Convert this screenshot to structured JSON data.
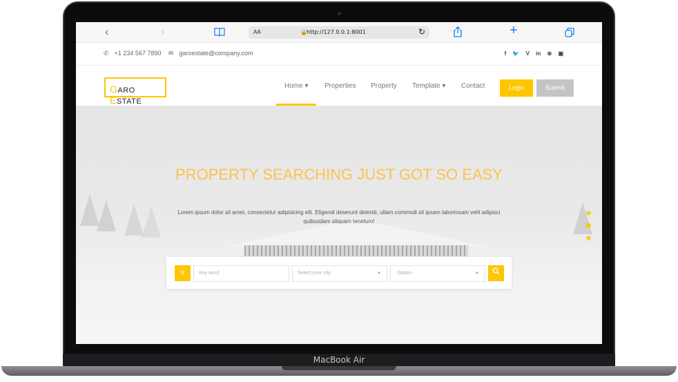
{
  "device": {
    "label": "MacBook Air"
  },
  "browser": {
    "back_icon": "‹",
    "forward_icon": "›",
    "bookmarks_icon": "book-icon",
    "text_size_label": "AA",
    "url": "http://127.0.0.1:8001",
    "reload_icon": "↻",
    "share_icon": "share-icon",
    "new_tab_icon": "+",
    "tabs_icon": "tabs-icon"
  },
  "topbar": {
    "phone": "+1 234 567 7890",
    "email": "garoestate@company.com",
    "social": [
      "f",
      "🐦",
      "V",
      "in",
      "⊛",
      "▣"
    ]
  },
  "nav": {
    "logo_first": "G",
    "logo_first_rest": "ARO",
    "logo_second": "E",
    "logo_second_rest": "STATE",
    "items": [
      "Home ▾",
      "Properties",
      "Property",
      "Template ▾",
      "Contact"
    ],
    "login_label": "Login",
    "submit_label": "Submit",
    "accent_color": "#fdc600"
  },
  "hero": {
    "title": "PROPERTY SEARCHING JUST GOT SO EASY",
    "subtitle": "Lorem ipsum dolor sit amet, consectetur adipisicing elit. Eligendi deserunt deleniti, ullam commodi sit ipsam laboriosam velit adipisci quibusdam aliquam teneturo!",
    "slider_dots": 3
  },
  "search": {
    "keyword_placeholder": "Key word",
    "city_placeholder": "Select your city",
    "status_placeholder": "-Status-"
  }
}
